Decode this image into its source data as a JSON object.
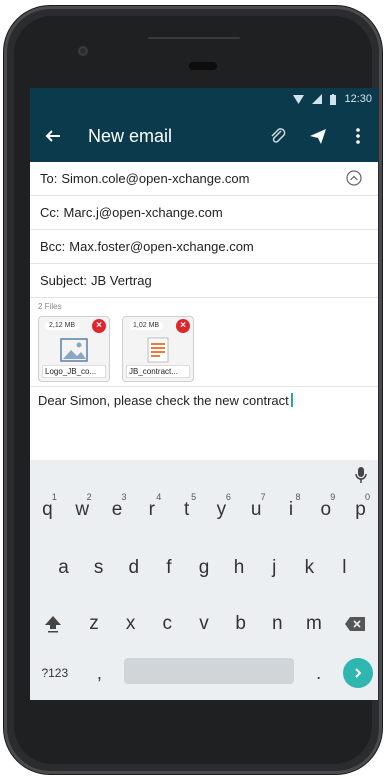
{
  "status": {
    "time": "12:30"
  },
  "appbar": {
    "title": "New email"
  },
  "fields": {
    "to": {
      "label": "To:",
      "value": "Simon.cole@open-xchange.com"
    },
    "cc": {
      "label": "Cc:",
      "value": "Marc.j@open-xchange.com"
    },
    "bcc": {
      "label": "Bcc:",
      "value": "Max.foster@open-xchange.com"
    },
    "subject": {
      "label": "Subject:",
      "value": "JB Vertrag"
    }
  },
  "attachments": {
    "count_label": "2 Files",
    "files": [
      {
        "size": "2,12 MB",
        "name": "Logo_JB_co...",
        "type": "image"
      },
      {
        "size": "1,02 MB",
        "name": "JB_contract...",
        "type": "document"
      }
    ]
  },
  "body": {
    "text": "Dear Simon, please check the new contract"
  },
  "keyboard": {
    "row1": [
      {
        "k": "q",
        "n": "1"
      },
      {
        "k": "w",
        "n": "2"
      },
      {
        "k": "e",
        "n": "3"
      },
      {
        "k": "r",
        "n": "4"
      },
      {
        "k": "t",
        "n": "5"
      },
      {
        "k": "y",
        "n": "6"
      },
      {
        "k": "u",
        "n": "7"
      },
      {
        "k": "i",
        "n": "8"
      },
      {
        "k": "o",
        "n": "9"
      },
      {
        "k": "p",
        "n": "0"
      }
    ],
    "row2": [
      "a",
      "s",
      "d",
      "f",
      "g",
      "h",
      "j",
      "k",
      "l"
    ],
    "row3": [
      "z",
      "x",
      "c",
      "v",
      "b",
      "n",
      "m"
    ],
    "sym_label": "?123",
    "comma": ",",
    "period": "."
  },
  "colors": {
    "appbar": "#0b3a4c",
    "accent": "#2fb6ae",
    "delete": "#e0262d"
  }
}
